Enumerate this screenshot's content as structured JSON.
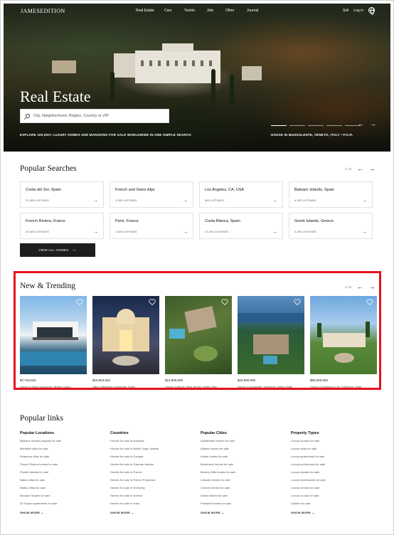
{
  "header": {
    "logo": "JAMESEDITION",
    "nav": [
      "Real Estate",
      "Cars",
      "Yachts",
      "Jets",
      "Other",
      "Journal"
    ],
    "sell": "Sell",
    "login": "Log in"
  },
  "hero": {
    "title": "Real Estate",
    "search_placeholder": "City, Neighborhood, Region, Country or ZIP",
    "caption": "EXPLORE 100,000+ LUXURY HOMES AND MANSIONS FOR SALE WORLDWIDE IN ONE SIMPLE SEARCH",
    "location": "HOUSE IN MUSSOLENTE, VENETO, ITALY • P.O.R.",
    "prev": "←",
    "next": "→"
  },
  "popular_searches": {
    "title": "Popular Searches",
    "pager": "1 / 4",
    "prev": "←",
    "next": "→",
    "items": [
      {
        "name": "Costa del Sol, Spain",
        "listings": "21,800 LISTINGS"
      },
      {
        "name": "French and Swiss Alps",
        "listings": "2,900 LISTINGS"
      },
      {
        "name": "Los Angeles, CA, USA",
        "listings": "400 LISTINGS"
      },
      {
        "name": "Balearic Islands, Spain",
        "listings": "4,000 LISTINGS"
      },
      {
        "name": "French Riviera, France",
        "listings": "10,600 LISTINGS"
      },
      {
        "name": "Paris, France",
        "listings": "1,600 LISTINGS"
      },
      {
        "name": "Costa Blanca, Spain",
        "listings": "21,000 LISTINGS"
      },
      {
        "name": "Greek Islands, Greece",
        "listings": "3,000 LISTINGS"
      }
    ],
    "arrow": "→",
    "view_all": "VIEW ALL HOMES",
    "view_all_arrow": "→"
  },
  "trending": {
    "title": "New & Trending",
    "pager": "1 / 3",
    "prev": "←",
    "next": "→",
    "items": [
      {
        "price": "$7,716,024",
        "title": "House in West Vancouver, British Colum"
      },
      {
        "price": "$10,903,032",
        "title": "Villa in Marbella, Andalusia, Spain"
      },
      {
        "price": "$21,500,000",
        "title": "House in Alpine, New Jersey, United Stat"
      },
      {
        "price": "$24,900,000",
        "title": "House in Annapolis, Maryland, United State"
      },
      {
        "price": "$50,000,000",
        "title": "House in Redwood City, California, Unite"
      }
    ]
  },
  "popular_links": {
    "title": "Popular links",
    "columns": [
      {
        "title": "Popular Locations",
        "items": [
          "Balearic Islands property for sale",
          "Marbella villas for sale",
          "Estepona villas for sale",
          "French Riviera homes for sale",
          "Phuket islands for sale",
          "Italian villas for sale",
          "Malibu villas for sale",
          "Monaco houses for sale",
          "St Tropez apartments for sale"
        ],
        "more": "SHOW MORE"
      },
      {
        "title": "Countries",
        "items": [
          "Homes for sale in Australia",
          "Homes for sale in British Virgin Islands",
          "Homes for sale in Canada",
          "Homes for sale in Cayman Islands",
          "Homes for sale in France",
          "Homes for sale in French Polynesia",
          "Homes for sale in Germany",
          "Homes for sale in Greece",
          "Homes for sale in India"
        ],
        "more": "SHOW MORE"
      },
      {
        "title": "Popular Cities",
        "items": [
          "Amsterdam homes for sale",
          "Atlanta homes for sale",
          "Austin homes for sale",
          "Benahavis homes for sale",
          "Beverly Hills homes for sale",
          "Cascais homes for sale",
          "Cannes homes for sale",
          "Dubai homes for sale",
          "Frankfurt homes for sale"
        ],
        "more": "SHOW MORE"
      },
      {
        "title": "Property Types",
        "items": [
          "Luxury houses for sale",
          "Luxury villas for sale",
          "Luxury apartments for sale",
          "Luxury penthouses for sale",
          "Luxury estates for sale",
          "Luxury townhouses for sale",
          "Luxury condos for sale",
          "Luxury co-ops for sale",
          "Castles for sale"
        ],
        "more": "SHOW MORE"
      }
    ]
  }
}
